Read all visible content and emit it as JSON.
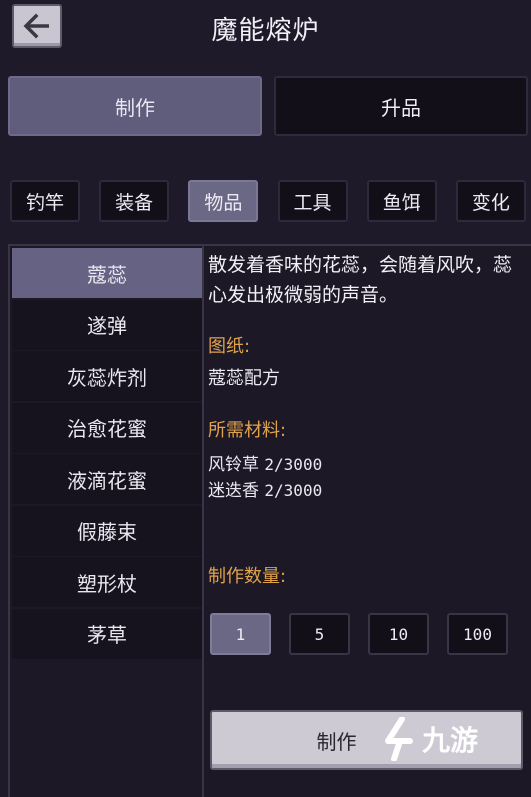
{
  "header": {
    "title": "魔能熔炉",
    "back_icon": "arrow-left-icon"
  },
  "tabs": [
    {
      "label": "制作",
      "active": true
    },
    {
      "label": "升品",
      "active": false
    }
  ],
  "categories": [
    {
      "label": "钓竿",
      "active": false
    },
    {
      "label": "装备",
      "active": false
    },
    {
      "label": "物品",
      "active": true
    },
    {
      "label": "工具",
      "active": false
    },
    {
      "label": "鱼饵",
      "active": false
    },
    {
      "label": "变化",
      "active": false
    }
  ],
  "items": [
    {
      "label": "蔻蕊",
      "active": true
    },
    {
      "label": "遂弹",
      "active": false
    },
    {
      "label": "灰蕊炸剂",
      "active": false
    },
    {
      "label": "治愈花蜜",
      "active": false
    },
    {
      "label": "液滴花蜜",
      "active": false
    },
    {
      "label": "假藤束",
      "active": false
    },
    {
      "label": "塑形杖",
      "active": false
    },
    {
      "label": "茅草",
      "active": false
    }
  ],
  "detail": {
    "description": "散发着香味的花蕊，会随着风吹，蕊心发出极微弱的声音。",
    "blueprint_label": "图纸:",
    "blueprint_value": "蔻蕊配方",
    "materials_label": "所需材料:",
    "materials": [
      {
        "name": "风铃草",
        "count": "2/3000"
      },
      {
        "name": "迷迭香",
        "count": "2/3000"
      }
    ],
    "quantity_label": "制作数量:"
  },
  "quantities": [
    {
      "label": "1",
      "active": true
    },
    {
      "label": "5",
      "active": false
    },
    {
      "label": "10",
      "active": false
    },
    {
      "label": "100",
      "active": false
    }
  ],
  "craft_button": {
    "label": "制作"
  },
  "watermark": {
    "text": "九游"
  },
  "colors": {
    "background": "#1f1a29",
    "active_tab": "#5f5c7c",
    "label_orange": "#e0a24b",
    "button_light": "#cdcad4"
  }
}
